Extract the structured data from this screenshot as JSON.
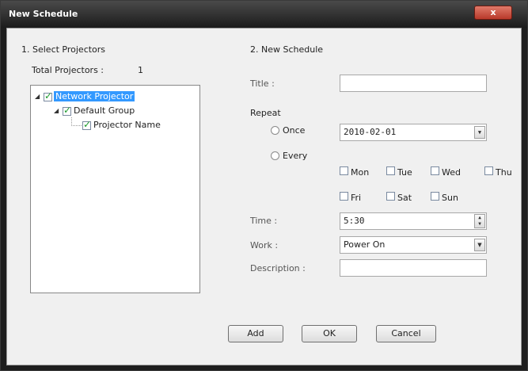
{
  "window": {
    "title": "New Schedule",
    "close_label": "x"
  },
  "left": {
    "section_title": "1. Select Projectors",
    "total_label": "Total Projectors :",
    "total_count": "1",
    "tree": {
      "root": {
        "label": "Network Projector",
        "checked": true
      },
      "group": {
        "label": "Default Group",
        "checked": true
      },
      "projector": {
        "label": "Projector Name",
        "checked": true
      }
    }
  },
  "right": {
    "section_title": "2. New Schedule",
    "title_label": "Title :",
    "title_value": "",
    "repeat_label": "Repeat",
    "once_label": "Once",
    "every_label": "Every",
    "date_value": "2010-02-01",
    "days": [
      "Mon",
      "Tue",
      "Wed",
      "Thu",
      "Fri",
      "Sat",
      "Sun"
    ],
    "time_label": "Time :",
    "time_value": "5:30",
    "work_label": "Work :",
    "work_value": "Power On",
    "description_label": "Description :",
    "description_value": ""
  },
  "buttons": {
    "add": "Add",
    "ok": "OK",
    "cancel": "Cancel"
  }
}
